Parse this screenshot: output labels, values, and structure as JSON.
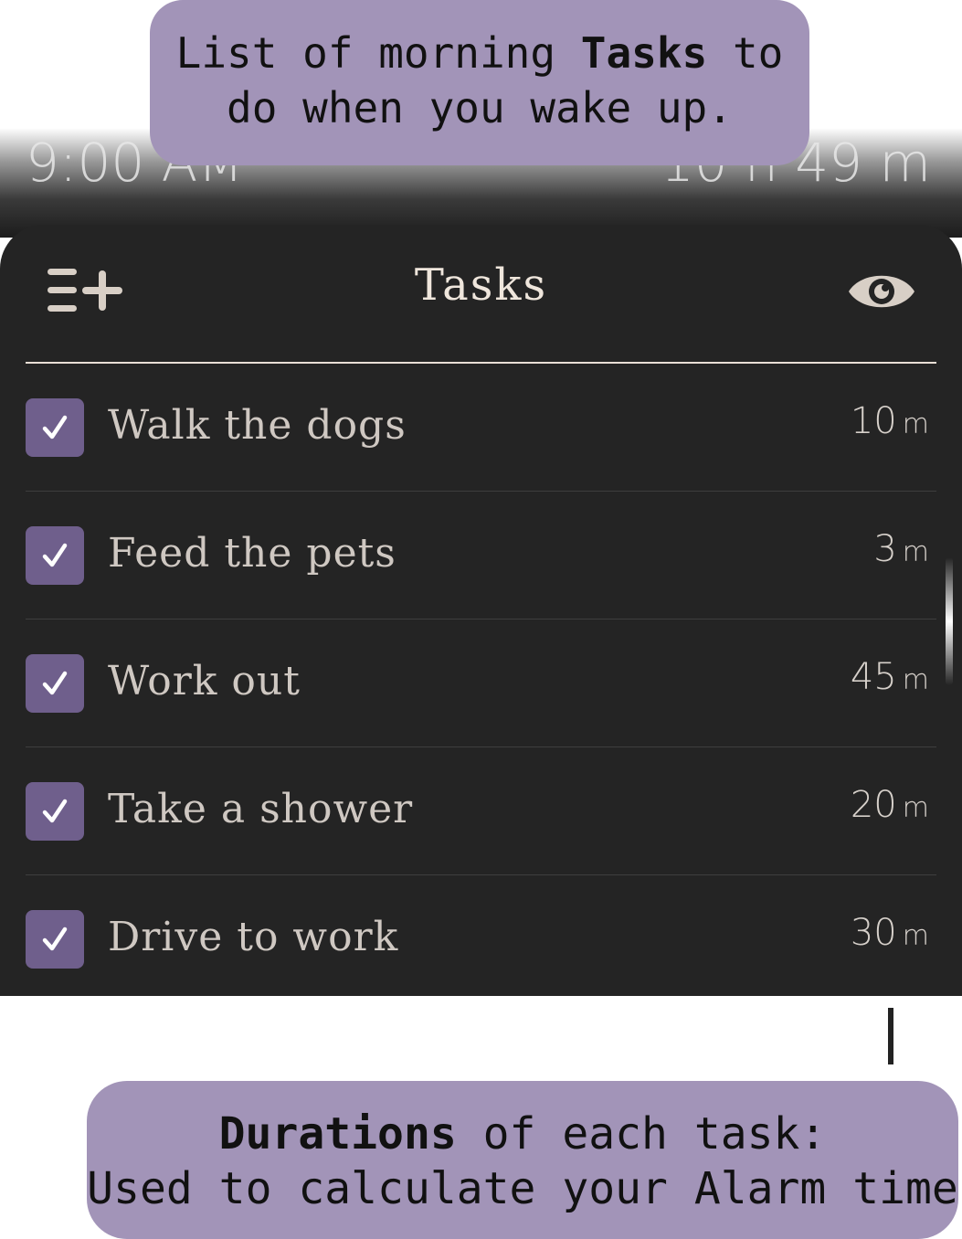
{
  "top_callout": {
    "line1_pre": "List of morning ",
    "line1_bold": "Tasks",
    "line1_post": " to",
    "line2": "do when you wake up."
  },
  "status": {
    "alarm_time": "9:00 AM",
    "time_until": "10 h 49 m"
  },
  "panel": {
    "title": "Tasks",
    "add_icon": "list-add-icon",
    "visibility_icon": "eye-icon"
  },
  "tasks": [
    {
      "label": "Walk the dogs",
      "duration": "10",
      "unit": "m",
      "checked": true
    },
    {
      "label": "Feed the pets",
      "duration": "3",
      "unit": "m",
      "checked": true
    },
    {
      "label": "Work out",
      "duration": "45",
      "unit": "m",
      "checked": true
    },
    {
      "label": "Take a shower",
      "duration": "20",
      "unit": "m",
      "checked": true
    },
    {
      "label": "Drive to work",
      "duration": "30",
      "unit": "m",
      "checked": true
    }
  ],
  "bottom_callout": {
    "line1_bold": "Durations",
    "line1_post": " of each task:",
    "line2": "Used to calculate your Alarm time"
  },
  "colors": {
    "panel_bg": "#242424",
    "checkbox": "#6f5f8c",
    "callout": "#a294b8",
    "title_text": "#efe6dc"
  }
}
